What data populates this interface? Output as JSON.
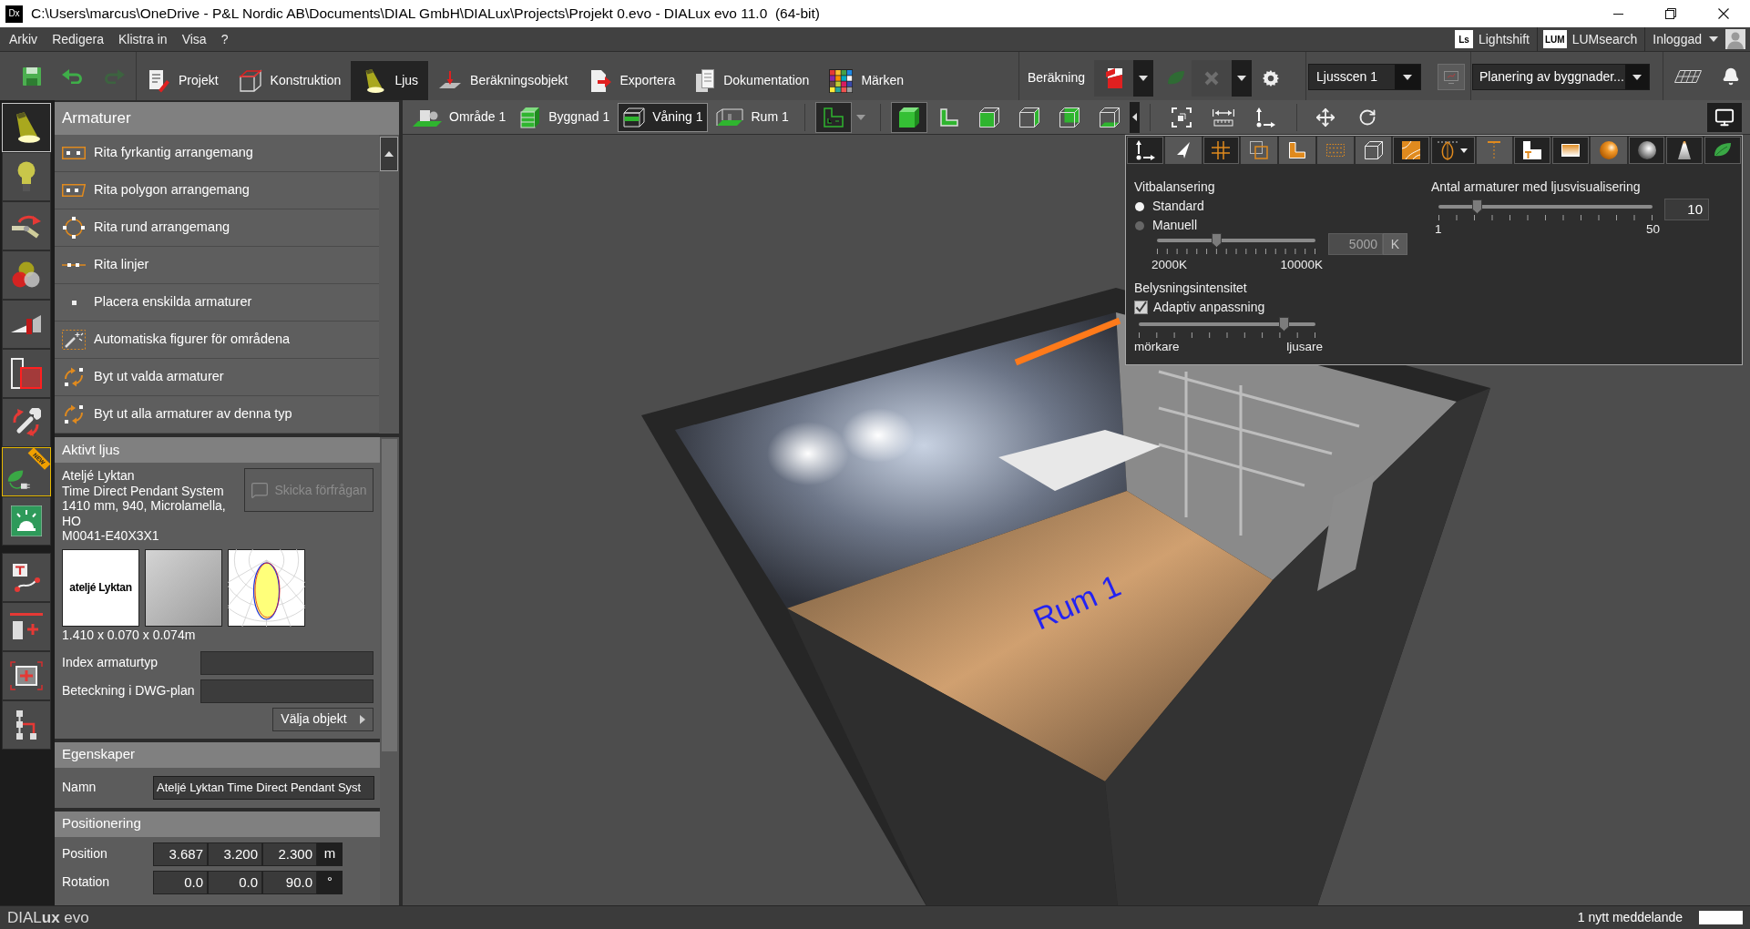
{
  "window": {
    "icon_text": "Dx",
    "title": "C:\\Users\\marcus\\OneDrive - P&L Nordic AB\\Documents\\DIAL GmbH\\DIALux\\Projects\\Projekt 0.evo - DIALux evo 11.0  (64-bit)"
  },
  "menu_bar": {
    "items": [
      "Arkiv",
      "Redigera",
      "Klistra in",
      "Visa",
      "?"
    ],
    "services": [
      {
        "logo": "Ls",
        "label": "Lightshift"
      },
      {
        "logo": "LUM",
        "label": "LUMsearch"
      }
    ],
    "account": "Inloggad"
  },
  "main_toolbar": {
    "tabs": [
      {
        "label": "Projekt",
        "selected": false
      },
      {
        "label": "Konstruktion",
        "selected": false
      },
      {
        "label": "Ljus",
        "selected": true
      },
      {
        "label": "Beräkningsobjekt",
        "selected": false
      },
      {
        "label": "Exportera",
        "selected": false
      },
      {
        "label": "Dokumentation",
        "selected": false
      },
      {
        "label": "Märken",
        "selected": false
      }
    ],
    "calculation_label": "Beräkning",
    "light_scene": "Ljusscen 1",
    "view_mode": "Planering av byggnader..."
  },
  "side_toolbar": {
    "groups": [
      [
        {
          "selected": true
        },
        {
          "selected": false
        },
        {
          "selected": false
        },
        {
          "selected": false
        },
        {
          "selected": false
        },
        {
          "selected": false
        },
        {
          "selected": false
        },
        {
          "selected": false,
          "badge": "NEW"
        },
        {
          "selected": false
        }
      ],
      [
        {
          "selected": false
        },
        {
          "selected": false
        },
        {
          "selected": false
        },
        {
          "selected": false
        }
      ]
    ]
  },
  "luminaire_panel": {
    "title": "Armaturer",
    "items": [
      "Rita fyrkantig arrangemang",
      "Rita polygon arrangemang",
      "Rita rund arrangemang",
      "Rita linjer",
      "Placera enskilda armaturer",
      "Automatiska figurer för områdena",
      "Byt ut valda armaturer",
      "Byt ut alla armaturer av denna typ"
    ]
  },
  "active_light": {
    "title": "Aktivt ljus",
    "manufacturer": "Ateljé Lyktan",
    "product": "Time Direct Pendant System 1410 mm, 940, Microlamella, HO",
    "article_number": "M0041-E40X3X1",
    "request_button": {
      "label": "Skicka förfrågan",
      "disabled": true
    },
    "logo_text": "ateljé Lyktan",
    "dimensions": "1.410 x 0.070 x 0.074m",
    "fields": [
      {
        "label": "Index armaturtyp"
      },
      {
        "label": "Beteckning i DWG-plan"
      }
    ],
    "select_button": "Välja objekt"
  },
  "properties": {
    "title": "Egenskaper",
    "fields": [
      {
        "label": "Namn",
        "value": "Ateljé Lyktan Time Direct Pendant Syst"
      }
    ]
  },
  "positioning": {
    "title": "Positionering",
    "rows": [
      {
        "label": "Position",
        "values": [
          "3.687",
          "3.200",
          "2.300"
        ],
        "unit": "m"
      },
      {
        "label": "Rotation",
        "values": [
          "0.0",
          "0.0",
          "90.0"
        ],
        "unit": "°"
      }
    ]
  },
  "viewport_toolbar": {
    "levels": [
      {
        "label": "Område 1",
        "selected": false
      },
      {
        "label": "Byggnad 1",
        "selected": false
      },
      {
        "label": "Våning 1",
        "selected": true
      },
      {
        "label": "Rum 1",
        "selected": false
      }
    ],
    "view_styles": [
      {
        "selected": true
      },
      {
        "selected": false
      },
      {
        "selected": false
      },
      {
        "selected": false
      },
      {
        "selected": false
      },
      {
        "selected": false
      }
    ]
  },
  "viewport": {
    "room_label": "Rum 1"
  },
  "display_panel": {
    "tools": [
      {
        "on": true
      },
      {
        "on": false
      },
      {
        "on": true
      },
      {
        "on": false
      },
      {
        "on": false
      },
      {
        "on": false
      },
      {
        "on": false
      },
      {
        "on": true
      },
      {
        "on": true
      },
      {
        "on": false
      },
      {
        "on": true
      },
      {
        "on": true
      },
      {
        "on": false
      },
      {
        "on": true
      },
      {
        "on": true
      },
      {
        "on": true
      }
    ],
    "white_balance": {
      "title": "Vitbalansering",
      "options": [
        {
          "label": "Standard",
          "selected": true
        },
        {
          "label": "Manuell",
          "selected": false
        }
      ],
      "slider": {
        "level": 0.375,
        "min_label": "2000K",
        "max_label": "10000K"
      },
      "kelvin": {
        "value": "5000",
        "unit": "K",
        "disabled": true
      }
    },
    "intensity": {
      "title": "Belysningsintensitet",
      "adaptive": {
        "label": "Adaptiv anpassning",
        "checked": true
      },
      "slider": {
        "level": 0.82,
        "min_label": "mörkare",
        "max_label": "ljusare"
      }
    },
    "luminaire_count": {
      "title": "Antal armaturer med ljusvisualisering",
      "slider": {
        "level": 0.18,
        "min_label": "1",
        "max_label": "50"
      },
      "value": "10"
    }
  },
  "status_bar": {
    "logo": "DIAL**ux** evo",
    "message": "1 nytt meddelande"
  }
}
